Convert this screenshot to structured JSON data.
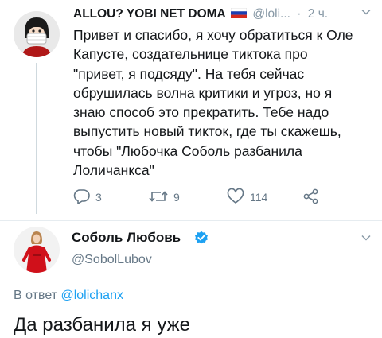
{
  "tweet1": {
    "display_name": "ALLOU? YOBI NET DOMA",
    "handle_truncated": "@loli...",
    "separator": "·",
    "time": "2 ч.",
    "body_lines": [
      "Привет и спасибо, я хочу обратиться к Оле",
      "Капусте, создательнице тиктока про",
      "\"привет, я подсяду\". На тебя сейчас",
      "обрушилась волна критики и угроз, но я",
      "знаю способ это прекратить. Тебе надо",
      "выпустить новый тикток, где ты скажешь,",
      "чтобы \"Любочка Соболь разбанила",
      "Лоличанкса\""
    ],
    "actions": {
      "reply_count": "3",
      "retweet_count": "9",
      "like_count": "114"
    },
    "icons": [
      "reply-icon",
      "retweet-icon",
      "like-icon",
      "share-icon",
      "chevron-down-icon",
      "russian-flag-icon"
    ]
  },
  "tweet2": {
    "display_name": "Соболь Любовь",
    "handle": "@SobolLubov",
    "reply_prefix": "В ответ",
    "reply_handle": "@lolichanx",
    "body": "Да разбанила я уже",
    "icons": [
      "verified-badge-icon",
      "chevron-down-icon"
    ]
  },
  "colors": {
    "text": "#14171a",
    "secondary": "#657786",
    "accent": "#1da1f2",
    "thread_line": "#cfd9de"
  }
}
